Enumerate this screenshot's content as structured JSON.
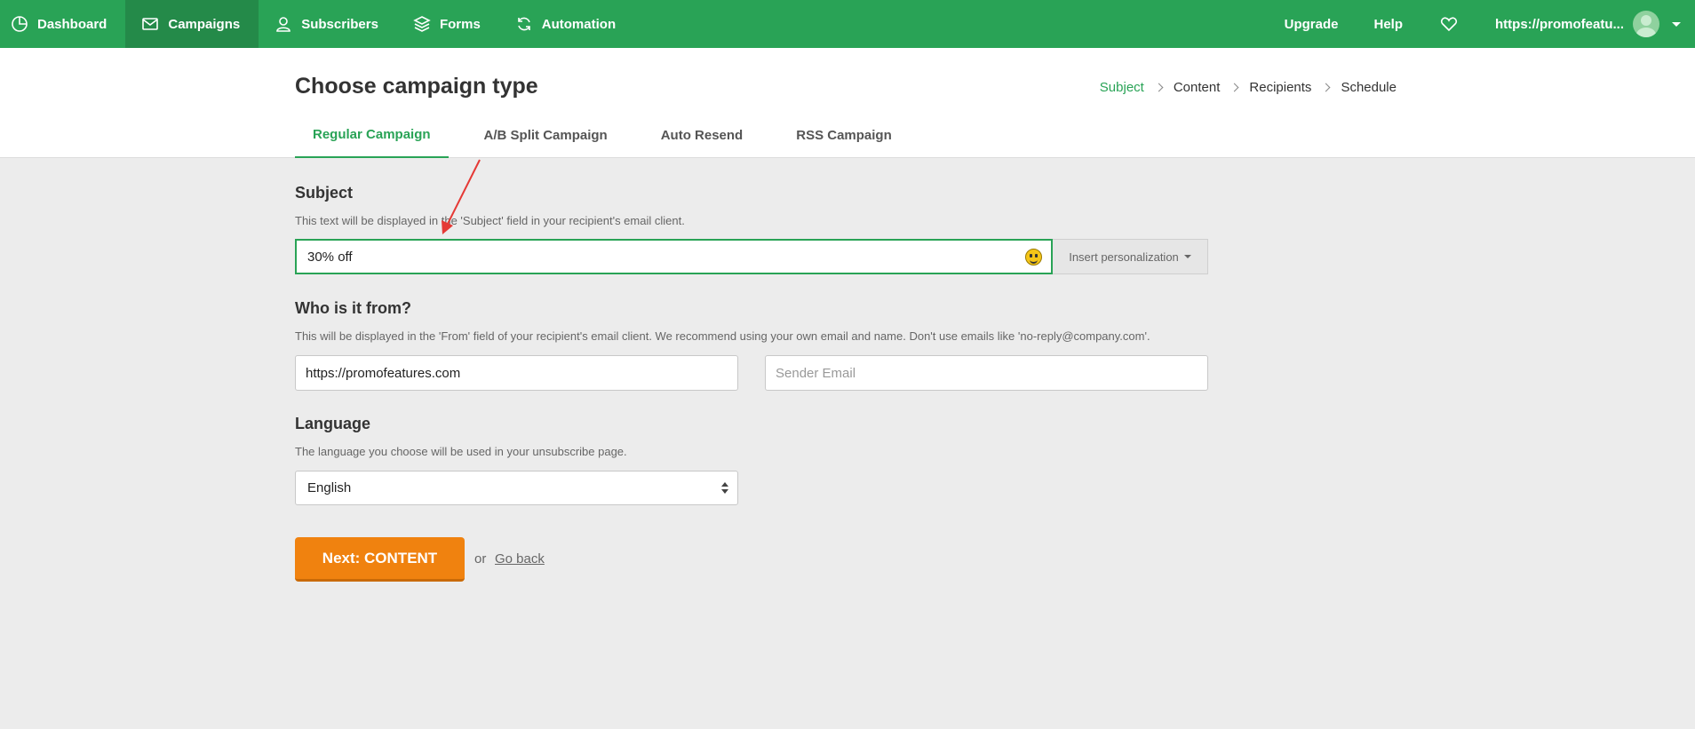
{
  "nav": {
    "items": [
      {
        "label": "Dashboard",
        "icon": "dashboard-icon"
      },
      {
        "label": "Campaigns",
        "icon": "mail-icon"
      },
      {
        "label": "Subscribers",
        "icon": "user-icon"
      },
      {
        "label": "Forms",
        "icon": "layers-icon"
      },
      {
        "label": "Automation",
        "icon": "refresh-icon"
      }
    ],
    "upgrade": "Upgrade",
    "help": "Help",
    "account": "https://promofeatu...",
    "brand_color": "#29a356"
  },
  "header": {
    "title": "Choose campaign type",
    "steps": [
      "Subject",
      "Content",
      "Recipients",
      "Schedule"
    ],
    "tabs": [
      "Regular Campaign",
      "A/B Split Campaign",
      "Auto Resend",
      "RSS Campaign"
    ]
  },
  "subject": {
    "title": "Subject",
    "help": "This text will be displayed in the 'Subject' field in your recipient's email client.",
    "value": "30% off",
    "personalize_label": "Insert personalization"
  },
  "from": {
    "title": "Who is it from?",
    "help": "This will be displayed in the 'From' field of your recipient's email client. We recommend using your own email and name. Don't use emails like 'no-reply@company.com'.",
    "name_value": "https://promofeatures.com",
    "email_placeholder": "Sender Email"
  },
  "language": {
    "title": "Language",
    "help": "The language you choose will be used in your unsubscribe page.",
    "selected": "English"
  },
  "actions": {
    "next_label": "Next: CONTENT",
    "or": "or",
    "back_label": "Go back",
    "button_color": "#f0820f"
  }
}
